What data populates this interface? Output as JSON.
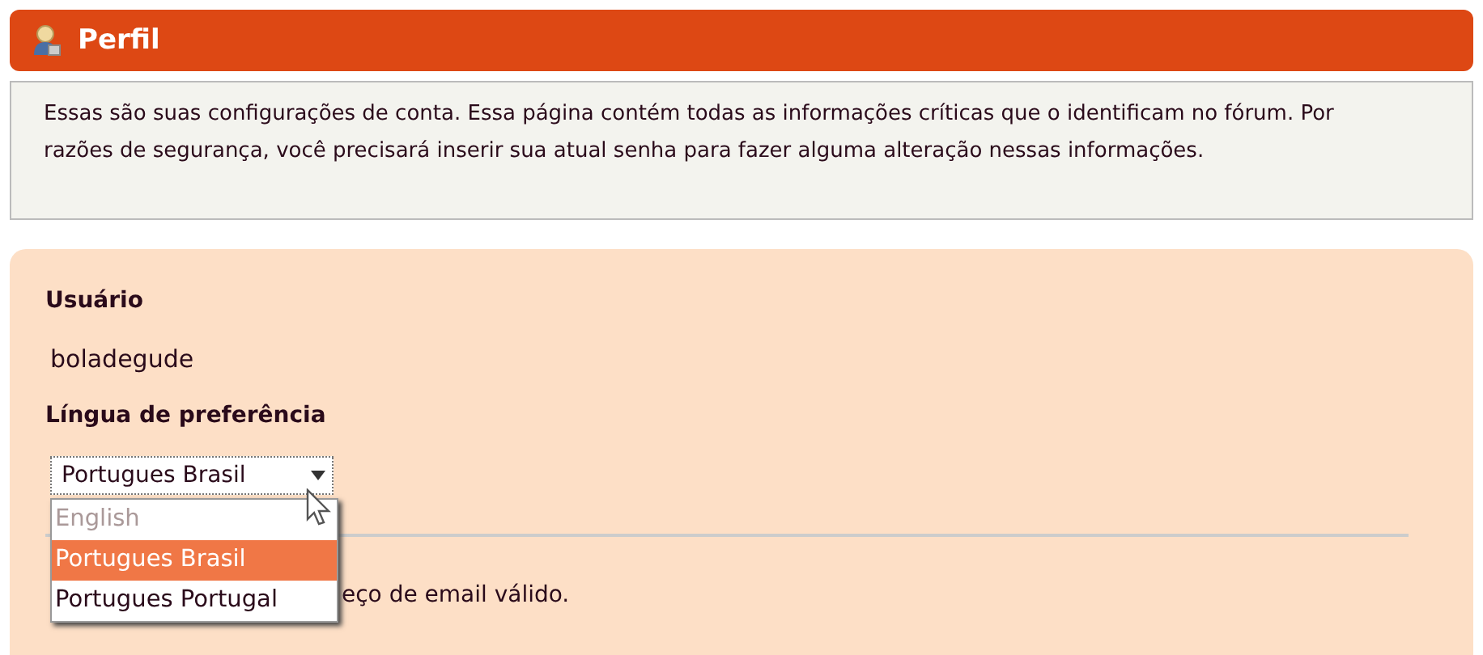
{
  "header": {
    "title": "Perfil"
  },
  "intro": "Essas são suas configurações de conta. Essa página contém todas as informações críticas que o identificam no fórum. Por razões de segurança, você precisará inserir sua atual senha para fazer alguma alteração nessas informações.",
  "username": {
    "label": "Usuário",
    "value": "boladegude"
  },
  "language": {
    "label": "Língua de preferência",
    "value": "Portugues Brasil",
    "expanded": true,
    "options": [
      {
        "label": "English",
        "selected": false,
        "disabled": true
      },
      {
        "label": "Portugues Brasil",
        "selected": true,
        "disabled": false
      },
      {
        "label": "Portugues Portugal",
        "selected": false,
        "disabled": false
      }
    ]
  },
  "email_hint": "eço de email válido."
}
